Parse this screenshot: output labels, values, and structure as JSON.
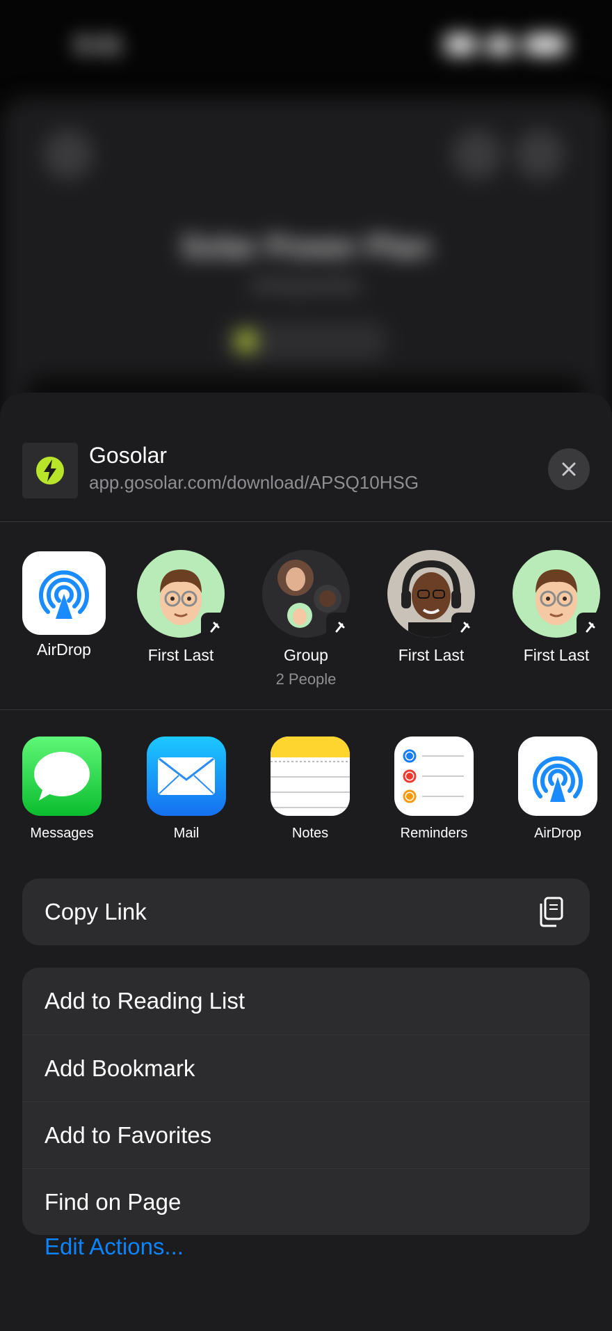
{
  "background": {
    "status_time": "9:41",
    "title": "Solar Power Plan",
    "subtitle": "APSQ10HSG"
  },
  "share_header": {
    "title": "Gosolar",
    "url": "app.gosolar.com/download/APSQ10HSG"
  },
  "people": [
    {
      "label": "AirDrop",
      "sub": ""
    },
    {
      "label": "First Last",
      "sub": ""
    },
    {
      "label": "Group",
      "sub": "2 People"
    },
    {
      "label": "First Last",
      "sub": ""
    },
    {
      "label": "First Last",
      "sub": ""
    }
  ],
  "apps": [
    {
      "label": "Messages",
      "icon": "messages-icon"
    },
    {
      "label": "Mail",
      "icon": "mail-icon"
    },
    {
      "label": "Notes",
      "icon": "notes-icon"
    },
    {
      "label": "Reminders",
      "icon": "reminders-icon"
    },
    {
      "label": "AirDrop",
      "icon": "airdrop-icon"
    }
  ],
  "actions": {
    "copy_link": "Copy Link",
    "add_reading_list": "Add to Reading List",
    "add_bookmark": "Add Bookmark",
    "add_favorites": "Add to Favorites",
    "find_on_page": "Find on Page",
    "edit_actions": "Edit Actions..."
  },
  "colors": {
    "sheet_bg": "#1c1c1e",
    "row_bg": "#2c2c2e",
    "accent": "#0a84ff",
    "secondary_text": "#8e8e93"
  }
}
